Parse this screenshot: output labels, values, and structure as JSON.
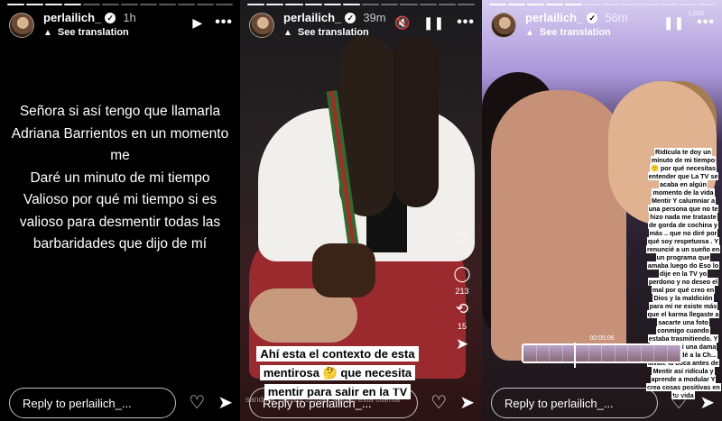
{
  "stories": [
    {
      "username": "perlailich_",
      "time": "1h",
      "translation_label": "See translation",
      "text_lines": [
        "Señora  si así tengo que llamarla",
        "Adriana Barrientos en un momento",
        "me",
        "Daré un minuto  de mi tiempo",
        "Valioso por qué  mi tiempo si es",
        "valioso  para desmentir todas las",
        "barbaridades que dijo de mí"
      ],
      "reply_placeholder": "Reply to perlailich_..."
    },
    {
      "username": "perlailich_",
      "time": "39m",
      "translation_label": "See translation",
      "side_counts": {
        "comments": "213",
        "reposts": "15"
      },
      "caption": "Ahí esta el  contexto de esta mentirosa 🤔 que necesita mentir para salir en la TV",
      "watermark": "sandrita_nans y 31más siguen esta cuenta",
      "reply_placeholder": "Reply to perlailich_..."
    },
    {
      "username": "perlailich_",
      "time": "56m",
      "translation_label": "See translation",
      "status_label": "Listo",
      "timestamp": "00:05:06",
      "overlay_text": "Ridícula te doy un minuto de mi tiempo 🙂 por qué necesitas entender que La TV se acaba en algún momento de la vida Mentir  Y calumniar  a una persona que no te hizo nada me trataste de gorda de cochina  y más .. que no diré por qué soy respetuosa . Y renuncié a un sueño en un programa que amaba luego do Eso lo dije en la TV yo perdono y no deseo el mal por qué creo en Dios y la maldición para mí ne existe más que el karma llegaste a sacarte una foto conmigo cuando estaba trasmitiendo. Y por qué fui una dama no te mandé a la  Ch... lávate la boca antes de Mentir así ridícula y aprende a modular  Y crea cosas positivas en tu vida",
      "reply_placeholder": "Reply to perlailich_..."
    }
  ],
  "icons": {
    "verified": "verified-badge-icon",
    "play": "play-icon",
    "pause": "pause-icon",
    "mute": "muted-speaker-icon",
    "more": "more-icon",
    "heart": "heart-icon",
    "send": "send-icon",
    "comment": "comment-icon",
    "repost": "repost-icon"
  }
}
